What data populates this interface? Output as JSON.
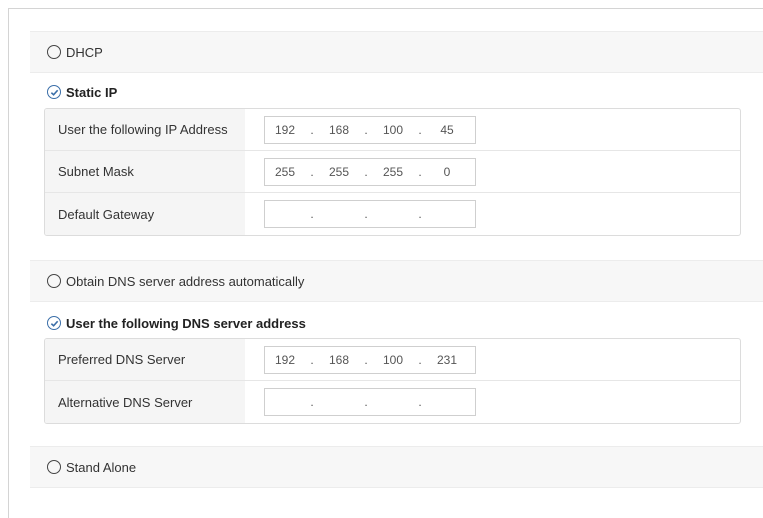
{
  "ip_mode": {
    "dhcp_label": "DHCP",
    "static_label": "Static IP",
    "selected": "static"
  },
  "static_ip": {
    "rows": [
      {
        "label": "User the following IP Address",
        "octets": [
          "192",
          "168",
          "100",
          "45"
        ]
      },
      {
        "label": "Subnet Mask",
        "octets": [
          "255",
          "255",
          "255",
          "0"
        ]
      },
      {
        "label": "Default Gateway",
        "octets": [
          "",
          "",
          "",
          ""
        ]
      }
    ]
  },
  "dns_mode": {
    "auto_label": "Obtain DNS server address automatically",
    "manual_label": "User the following DNS server address",
    "selected": "manual"
  },
  "dns": {
    "rows": [
      {
        "label": "Preferred DNS Server",
        "octets": [
          "192",
          "168",
          "100",
          "231"
        ]
      },
      {
        "label": "Alternative DNS Server",
        "octets": [
          "",
          "",
          "",
          ""
        ]
      }
    ]
  },
  "standalone": {
    "label": "Stand Alone"
  },
  "colors": {
    "accent": "#3a6ea8",
    "section_bg": "#f7f7f7",
    "label_bg": "#f5f5f5"
  },
  "icons": {
    "radio_on": "radio-checked-icon",
    "radio_off": "radio-unchecked-icon"
  }
}
